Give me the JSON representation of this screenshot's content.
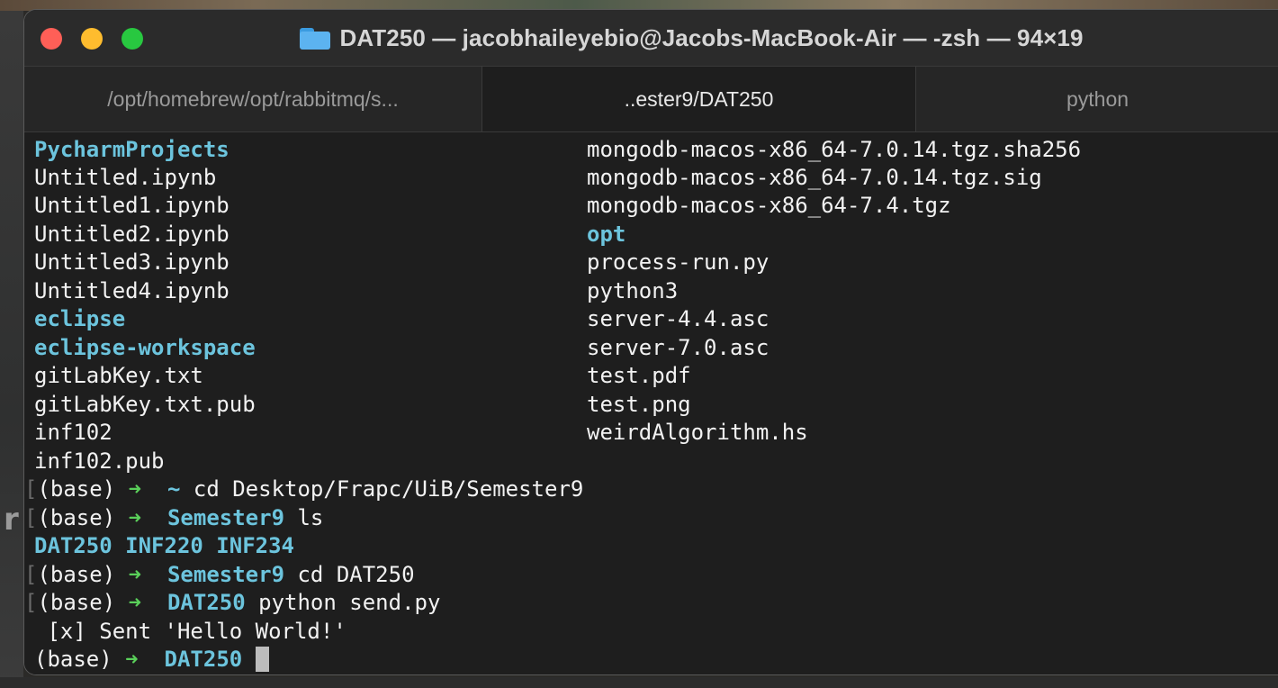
{
  "window": {
    "title": "DAT250 — jacobhaileyebio@Jacobs-MacBook-Air — -zsh — 94×19"
  },
  "tabs": [
    {
      "label": "/opt/homebrew/opt/rabbitmq/s..."
    },
    {
      "label": "..ester9/DAT250"
    },
    {
      "label": "python"
    }
  ],
  "listing_left": [
    {
      "name": "PycharmProjects",
      "kind": "dir"
    },
    {
      "name": "Untitled.ipynb",
      "kind": "file"
    },
    {
      "name": "Untitled1.ipynb",
      "kind": "file"
    },
    {
      "name": "Untitled2.ipynb",
      "kind": "file"
    },
    {
      "name": "Untitled3.ipynb",
      "kind": "file"
    },
    {
      "name": "Untitled4.ipynb",
      "kind": "file"
    },
    {
      "name": "eclipse",
      "kind": "dir"
    },
    {
      "name": "eclipse-workspace",
      "kind": "dir"
    },
    {
      "name": "gitLabKey.txt",
      "kind": "file"
    },
    {
      "name": "gitLabKey.txt.pub",
      "kind": "file"
    },
    {
      "name": "inf102",
      "kind": "file"
    },
    {
      "name": "inf102.pub",
      "kind": "file"
    }
  ],
  "listing_right": [
    {
      "name": "mongodb-macos-x86_64-7.0.14.tgz.sha256",
      "kind": "file"
    },
    {
      "name": "mongodb-macos-x86_64-7.0.14.tgz.sig",
      "kind": "file"
    },
    {
      "name": "mongodb-macos-x86_64-7.4.tgz",
      "kind": "file"
    },
    {
      "name": "opt",
      "kind": "dir"
    },
    {
      "name": "process-run.py",
      "kind": "file"
    },
    {
      "name": "python3",
      "kind": "file"
    },
    {
      "name": "server-4.4.asc",
      "kind": "file"
    },
    {
      "name": "server-7.0.asc",
      "kind": "file"
    },
    {
      "name": "test.pdf",
      "kind": "file"
    },
    {
      "name": "test.png",
      "kind": "file"
    },
    {
      "name": "weirdAlgorithm.hs",
      "kind": "file"
    }
  ],
  "session": [
    {
      "type": "prompt",
      "marker": "[",
      "env": "(base)",
      "arrow": "➜",
      "dir": "~",
      "cmd": "cd Desktop/Frapc/UiB/Semester9"
    },
    {
      "type": "prompt",
      "marker": "[",
      "env": "(base)",
      "arrow": "➜",
      "dir": "Semester9",
      "cmd": "ls"
    },
    {
      "type": "output_dirs",
      "text": "DAT250 INF220 INF234"
    },
    {
      "type": "prompt",
      "marker": "[",
      "env": "(base)",
      "arrow": "➜",
      "dir": "Semester9",
      "cmd": "cd DAT250"
    },
    {
      "type": "prompt",
      "marker": "[",
      "env": "(base)",
      "arrow": "➜",
      "dir": "DAT250",
      "cmd": "python send.py"
    },
    {
      "type": "output",
      "text": " [x] Sent 'Hello World!'"
    },
    {
      "type": "prompt",
      "marker": "",
      "env": "(base)",
      "arrow": "➜",
      "dir": "DAT250",
      "cmd": ""
    }
  ],
  "desktop": {
    "left_edge_glyph": "r"
  },
  "colors": {
    "close": "#ff5f57",
    "minimize": "#febc2e",
    "maximize": "#28c840",
    "directory": "#6cc4dd",
    "prompt_arrow": "#5ad05a",
    "terminal_bg": "#1e1e1e"
  }
}
